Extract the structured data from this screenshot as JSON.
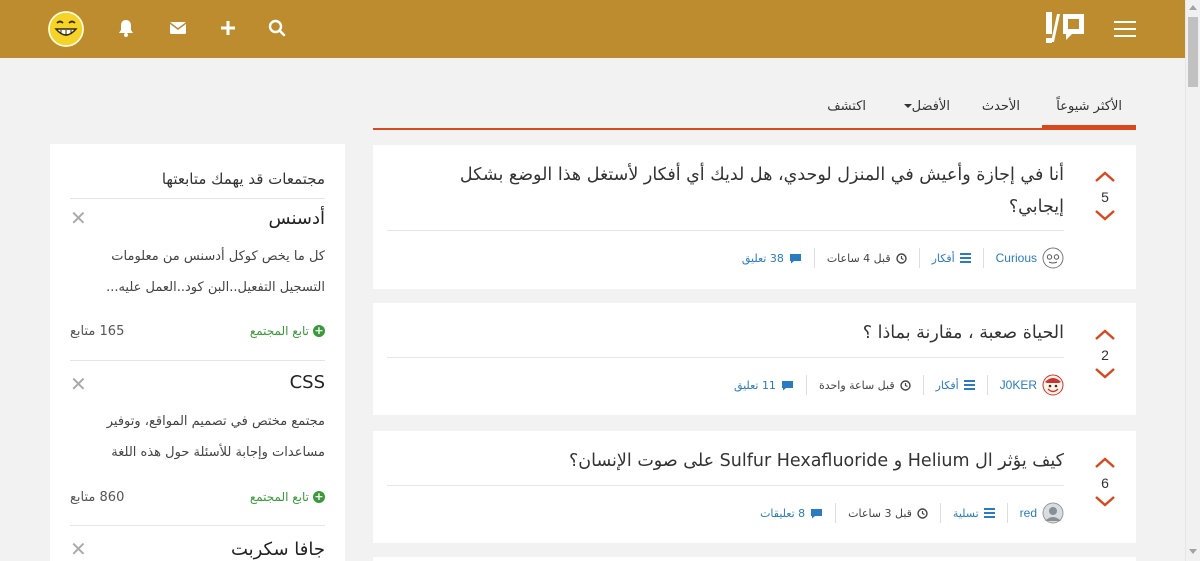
{
  "header": {
    "icons": [
      "menu-icon",
      "logo",
      "search-icon",
      "plus-icon",
      "mail-icon",
      "bell-icon",
      "user-avatar"
    ],
    "colors": {
      "bar": "#bd8c2e",
      "accent": "#d9481c",
      "link": "#2a7bc2",
      "follow": "#3a9a3a"
    }
  },
  "tabs": [
    {
      "label": "الأكثر شيوعاً",
      "active": true
    },
    {
      "label": "الأحدث",
      "active": false
    },
    {
      "label": "الأفضل",
      "active": false,
      "dropdown": true
    },
    {
      "label": "اكتشف",
      "active": false
    }
  ],
  "posts": [
    {
      "title": "أنا في إجازة وأعيش في المنزل لوحدي، هل لديك أي أفكار لأستغل هذا الوضع بشكل إيجابي؟",
      "votes": "5",
      "user": "Curious",
      "category": "أفكار",
      "time": "قبل 4 ساعات",
      "comments": "38 تعليق"
    },
    {
      "title": "الحياة صعبة ، مقارنة بماذا ؟",
      "votes": "2",
      "user": "J0KER",
      "category": "أفكار",
      "time": "قبل ساعة واحدة",
      "comments": "11 تعليق"
    },
    {
      "title": "كيف يؤثر ال Helium و Sulfur Hexafluoride على صوت الإنسان؟",
      "votes": "6",
      "user": "red",
      "category": "تسلية",
      "time": "قبل 3 ساعات",
      "comments": "8 تعليقات"
    }
  ],
  "sidebar": {
    "title": "مجتمعات قد يهمك متابعتها",
    "communities": [
      {
        "name": "أدسنس",
        "desc": "كل ما يخص كوكل أدسنس من معلومات التسجيل التفعيل..البن كود..العمل عليه...",
        "follow": "تابع المجتمع",
        "followers": "165 متابع"
      },
      {
        "name": "CSS",
        "desc": "مجتمع مختص في تصميم المواقع، وتوفير مساعدات وإجابة للأسئلة حول هذه اللغة",
        "follow": "تابع المجتمع",
        "followers": "860 متابع"
      },
      {
        "name": "جافا سكربت"
      }
    ]
  }
}
